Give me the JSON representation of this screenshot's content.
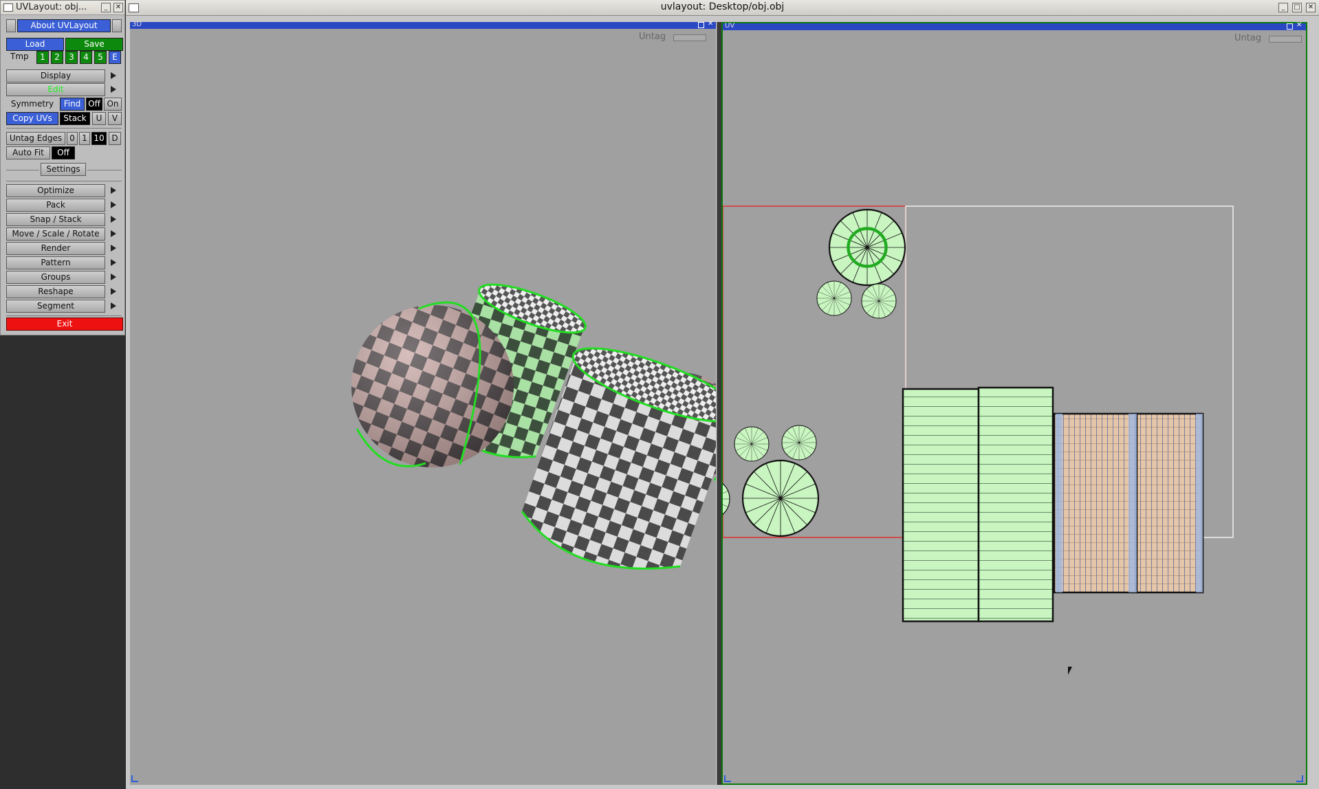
{
  "tool_window": {
    "title": "UVLayout: obj.",
    "title_ellipsis": "..",
    "about_button": "About UVLayout",
    "load_button": "Load",
    "save_button": "Save",
    "tmp_label": "Tmp",
    "tmp_slots": [
      "1",
      "2",
      "3",
      "4",
      "5",
      "E"
    ],
    "display_menu": "Display",
    "edit_menu": "Edit",
    "symmetry_label": "Symmetry",
    "symmetry_find": "Find",
    "symmetry_off": "Off",
    "symmetry_on": "On",
    "copy_uvs": "Copy UVs",
    "stack": "Stack",
    "u_button": "U",
    "v_button": "V",
    "untag_edges": "Untag Edges",
    "untag_values": [
      "0",
      "1",
      "10",
      "D"
    ],
    "auto_fit": "Auto Fit",
    "auto_fit_value": "Off",
    "settings": "Settings",
    "menus": [
      "Optimize",
      "Pack",
      "Snap / Stack",
      "Move / Scale / Rotate",
      "Render",
      "Pattern",
      "Groups",
      "Reshape",
      "Segment"
    ],
    "exit_button": "Exit"
  },
  "main_window": {
    "title": "uvlayout: Desktop/obj.obj",
    "viewport_3d_label": "3D",
    "viewport_uv_label": "UV",
    "untag_label": "Untag"
  },
  "colors": {
    "accent_blue": "#3a5fd6",
    "green": "#0d8a0d",
    "exit_red": "#ee1111",
    "viewport_bg": "#a0a0a0",
    "uv_shell": "#c8f5c0",
    "seam_green": "#22dd22"
  }
}
